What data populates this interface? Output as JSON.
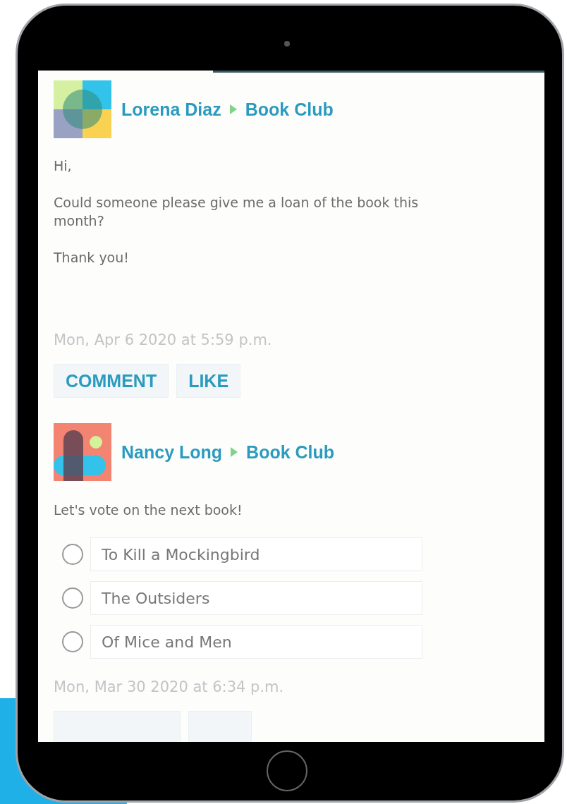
{
  "posts": [
    {
      "kind": "text",
      "author": "Lorena Diaz",
      "group": "Book Club",
      "paragraphs": [
        "Hi,",
        "Could someone please give me a loan of the book this month?",
        "Thank you!"
      ],
      "timestamp": "Mon, Apr 6 2020 at 5:59 p.m.",
      "actions": [
        "COMMENT",
        "LIKE"
      ]
    },
    {
      "kind": "poll",
      "author": "Nancy Long",
      "group": "Book Club",
      "paragraphs": [
        "Let's vote on the next book!"
      ],
      "options": [
        {
          "label": "To Kill a Mockingbird",
          "selected": false
        },
        {
          "label": "The Outsiders",
          "selected": false
        },
        {
          "label": "Of Mice and Men",
          "selected": false
        }
      ],
      "timestamp": "Mon, Mar 30 2020 at 6:34 p.m."
    }
  ]
}
